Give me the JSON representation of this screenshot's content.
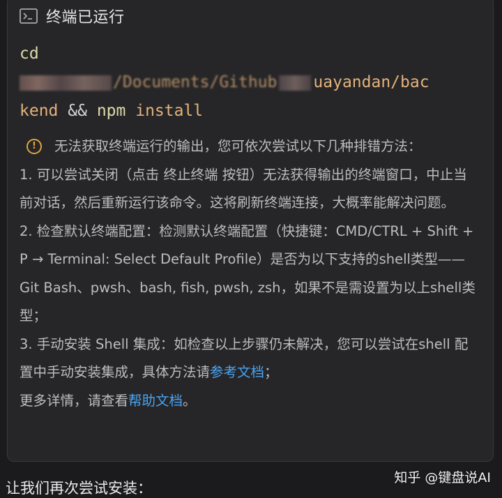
{
  "panel": {
    "title": "终端已运行",
    "icon": "terminal-icon",
    "command": {
      "word_cd": "cd",
      "path_visible_1": "uayandan/bac",
      "path_blurred": "/Documents/Github",
      "path_visible_2": "kend",
      "operator": "&&",
      "word_npm": "npm",
      "word_install": "install"
    }
  },
  "notice": {
    "icon": "warning-icon",
    "headline": "无法获取终端运行的输出，您可依次尝试以下几种排错方法：",
    "step1": "1. 可以尝试关闭（点击 终止终端 按钮）无法获得输出的终端窗口，中止当前对话，然后重新运行该命令。这将刷新终端连接，大概率能解决问题。",
    "step2": "2. 检查默认终端配置：检测默认终端配置（快捷键：CMD/CTRL + Shift + P → Terminal: Select Default Profile）是否为以下支持的shell类型——Git Bash、pwsh、bash, fish, pwsh, zsh，如果不是需设置为以上shell类型；",
    "step3_text": "3. 手动安装 Shell 集成：如检查以上步骤仍未解决，您可以尝试在shell 配置中手动安装集成，具体方法请",
    "step3_link": "参考文档",
    "step3_end": "；",
    "more_text": "更多详情，请查看",
    "more_link": "帮助文档",
    "more_end": "。"
  },
  "footer": {
    "text": "让我们再次尝试安装：",
    "watermark": "知乎 @键盘说AI"
  },
  "colors": {
    "background": "#1b1b1d",
    "panel": "#262628",
    "warning": "#e0a63a",
    "link": "#4aa3f0",
    "command": "#e3b27c"
  }
}
